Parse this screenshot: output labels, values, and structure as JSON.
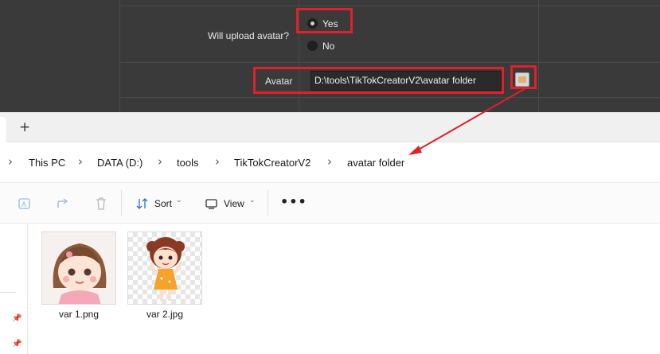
{
  "settings": {
    "upload_label": "Will upload avatar?",
    "options": [
      {
        "label": "Yes",
        "selected": true
      },
      {
        "label": "No",
        "selected": false
      }
    ],
    "avatar_label": "Avatar",
    "avatar_path": "D:\\tools\\TikTokCreatorV2\\avatar folder",
    "browse_icon": "folder-browse-icon",
    "highlight_color": "#e0202a"
  },
  "explorer": {
    "new_tab_label": "+",
    "breadcrumb": [
      "This PC",
      "DATA (D:)",
      "tools",
      "TikTokCreatorV2",
      "avatar folder"
    ],
    "toolbar": {
      "sort_label": "Sort",
      "view_label": "View",
      "more_label": "•••"
    },
    "files": [
      {
        "name": "var 1.png",
        "thumbnail": "girl-avatar-pink"
      },
      {
        "name": "var 2.jpg",
        "thumbnail": "girl-avatar-orange-dress"
      }
    ]
  }
}
